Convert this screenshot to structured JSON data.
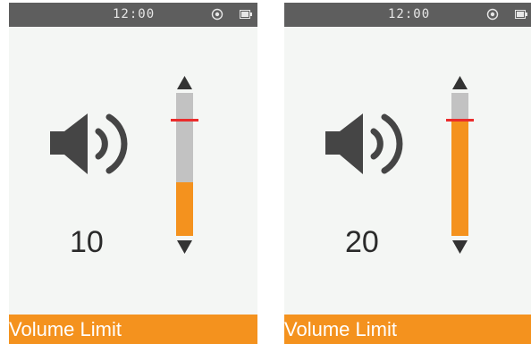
{
  "accent_color": "#f4921e",
  "limit_color": "#ea2c2c",
  "screens": [
    {
      "status": {
        "time": "12:00",
        "icons": [
          "wifi-icon",
          "battery-icon"
        ]
      },
      "volume": {
        "value": "10",
        "level": 0.375,
        "limit": 0.81
      },
      "bottom_label": "Volume Limit"
    },
    {
      "status": {
        "time": "12:00",
        "icons": [
          "wifi-icon",
          "battery-icon"
        ]
      },
      "volume": {
        "value": "20",
        "level": 0.81,
        "limit": 0.81
      },
      "bottom_label": "Volume Limit"
    }
  ]
}
